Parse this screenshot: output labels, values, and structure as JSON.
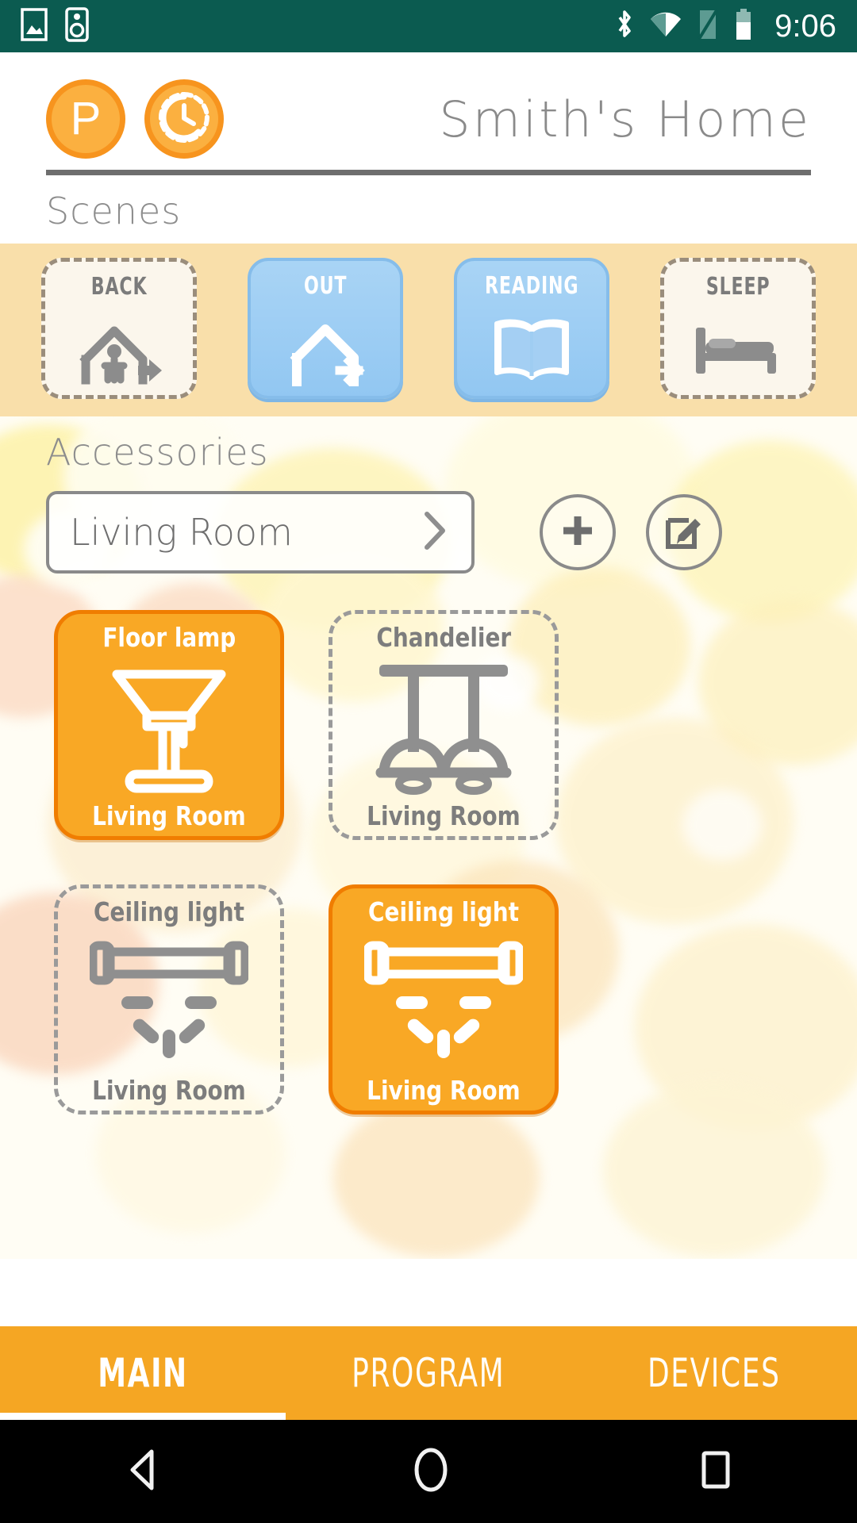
{
  "statusbar": {
    "time": "9:06",
    "left_icons": [
      "image-icon",
      "speaker-icon"
    ],
    "right_icons": [
      "bluetooth-icon",
      "wifi-icon",
      "sim-card-icon",
      "battery-icon"
    ],
    "background_color": "#0b5b50"
  },
  "header": {
    "title": "Smith's Home",
    "program_button_label": "P",
    "timer_button_label": "timer-icon",
    "accent_color": "#f7941e"
  },
  "scenes": {
    "title": "Scenes",
    "band_color": "#f9dfaa",
    "active_color": "#92c7f2",
    "items": [
      {
        "label": "BACK",
        "icon": "house-enter-icon",
        "active": false
      },
      {
        "label": "OUT",
        "icon": "house-exit-icon",
        "active": true
      },
      {
        "label": "READING",
        "icon": "open-book-icon",
        "active": true
      },
      {
        "label": "SLEEP",
        "icon": "bed-icon",
        "active": false
      }
    ]
  },
  "accessories": {
    "title": "Accessories",
    "room_selector": {
      "value": "Living Room",
      "chevron": "chevron-right-icon"
    },
    "add_button": "plus-icon",
    "edit_button": "edit-pencil-icon",
    "active_color": "#f9a825",
    "devices": [
      {
        "name": "Floor lamp",
        "room": "Living Room",
        "icon": "floor-lamp-icon",
        "active": true
      },
      {
        "name": "Chandelier",
        "room": "Living Room",
        "icon": "chandelier-icon",
        "active": false
      },
      {
        "name": "Ceiling light",
        "room": "Living Room",
        "icon": "ceiling-light-icon",
        "active": false
      },
      {
        "name": "Ceiling light",
        "room": "Living Room",
        "icon": "ceiling-light-icon",
        "active": true
      }
    ]
  },
  "tabbar": {
    "background_color": "#f5a623",
    "tabs": [
      {
        "label": "MAIN",
        "active": true
      },
      {
        "label": "PROGRAM",
        "active": false
      },
      {
        "label": "DEVICES",
        "active": false
      }
    ]
  },
  "navbar": {
    "back": "back-triangle-icon",
    "home": "home-circle-icon",
    "recents": "recents-square-icon"
  }
}
